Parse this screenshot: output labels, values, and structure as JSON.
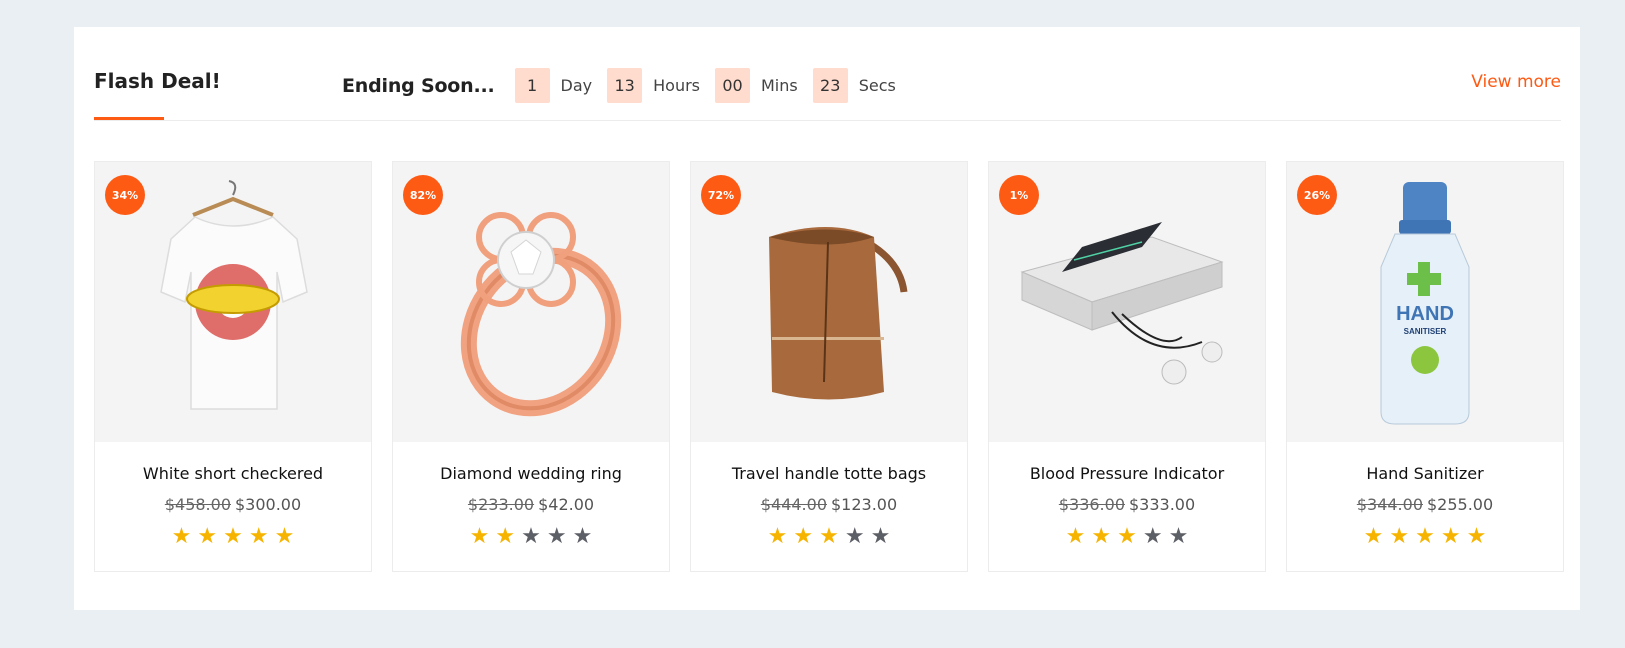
{
  "section": {
    "title": "Flash Deal!",
    "ending_label": "Ending Soon...",
    "view_more": "View more"
  },
  "countdown": [
    {
      "value": "1",
      "unit": "Day"
    },
    {
      "value": "13",
      "unit": "Hours"
    },
    {
      "value": "00",
      "unit": "Mins"
    },
    {
      "value": "23",
      "unit": "Secs"
    }
  ],
  "colors": {
    "accent": "#fd5a14",
    "countdown_bg": "#ffdccd",
    "star_on": "#f6b400",
    "star_off": "#5c5f66"
  },
  "products": [
    {
      "name": "White short checkered",
      "discount": "34%",
      "old_price": "$458.00",
      "price": "$300.00",
      "rating": 5,
      "icon": "tshirt-icon"
    },
    {
      "name": "Diamond wedding ring",
      "discount": "82%",
      "old_price": "$233.00",
      "price": "$42.00",
      "rating": 2,
      "icon": "ring-icon"
    },
    {
      "name": "Travel handle totte bags",
      "discount": "72%",
      "old_price": "$444.00",
      "price": "$123.00",
      "rating": 3,
      "icon": "bag-icon"
    },
    {
      "name": "Blood Pressure Indicator",
      "discount": "1%",
      "old_price": "$336.00",
      "price": "$333.00",
      "rating": 3,
      "icon": "medical-device-icon"
    },
    {
      "name": "Hand Sanitizer",
      "discount": "26%",
      "old_price": "$344.00",
      "price": "$255.00",
      "rating": 5,
      "icon": "sanitizer-bottle-icon",
      "label_brand": "HAND",
      "label_sub": "SANITISER"
    }
  ]
}
